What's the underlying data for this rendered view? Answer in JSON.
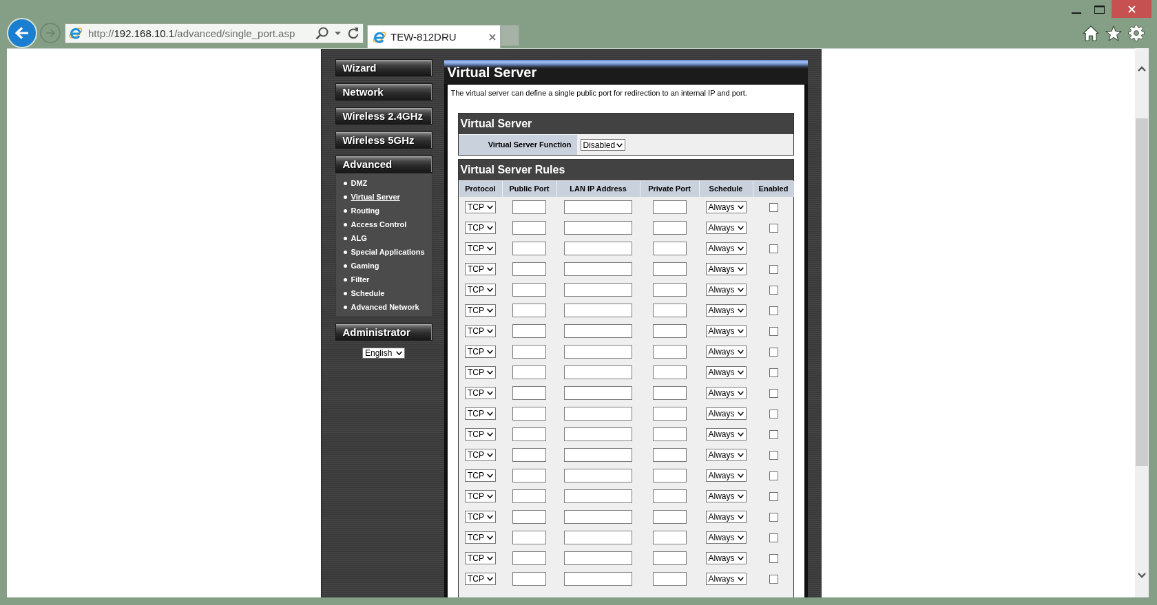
{
  "nav": {
    "back": {
      "disabled": false
    },
    "forward": {
      "disabled": true
    }
  },
  "address_bar": {
    "scheme": "http://",
    "host": "192.168.10.1",
    "path": "/advanced/single_port.asp"
  },
  "tabs": [
    {
      "title": "TEW-812DRU",
      "selected": true
    }
  ],
  "sidebar": {
    "sections": [
      {
        "label": "Wizard"
      },
      {
        "label": "Network"
      },
      {
        "label": "Wireless 2.4GHz"
      },
      {
        "label": "Wireless 5GHz"
      },
      {
        "label": "Advanced",
        "items": [
          {
            "label": "DMZ",
            "selected": false
          },
          {
            "label": "Virtual Server",
            "selected": true
          },
          {
            "label": "Routing",
            "selected": false
          },
          {
            "label": "Access Control",
            "selected": false
          },
          {
            "label": "ALG",
            "selected": false
          },
          {
            "label": "Special Applications",
            "selected": false
          },
          {
            "label": "Gaming",
            "selected": false
          },
          {
            "label": "Filter",
            "selected": false
          },
          {
            "label": "Schedule",
            "selected": false
          },
          {
            "label": "Advanced Network",
            "selected": false
          }
        ]
      },
      {
        "label": "Administrator"
      }
    ],
    "language": "English"
  },
  "main": {
    "title": "Virtual Server",
    "description": "The virtual server can define a single public port for redirection to an internal IP and port.",
    "function": {
      "title": "Virtual Server",
      "label": "Virtual Server Function",
      "value": "Disabled"
    },
    "rules": {
      "title": "Virtual Server Rules",
      "columns": [
        "Protocol",
        "Public Port",
        "LAN IP Address",
        "Private Port",
        "Schedule",
        "Enabled"
      ],
      "rows": [
        {
          "protocol": "TCP",
          "schedule": "Always",
          "enabled": false
        },
        {
          "protocol": "TCP",
          "schedule": "Always",
          "enabled": false
        },
        {
          "protocol": "TCP",
          "schedule": "Always",
          "enabled": false
        },
        {
          "protocol": "TCP",
          "schedule": "Always",
          "enabled": false
        },
        {
          "protocol": "TCP",
          "schedule": "Always",
          "enabled": false
        },
        {
          "protocol": "TCP",
          "schedule": "Always",
          "enabled": false
        },
        {
          "protocol": "TCP",
          "schedule": "Always",
          "enabled": false
        },
        {
          "protocol": "TCP",
          "schedule": "Always",
          "enabled": false
        },
        {
          "protocol": "TCP",
          "schedule": "Always",
          "enabled": false
        },
        {
          "protocol": "TCP",
          "schedule": "Always",
          "enabled": false
        },
        {
          "protocol": "TCP",
          "schedule": "Always",
          "enabled": false
        },
        {
          "protocol": "TCP",
          "schedule": "Always",
          "enabled": false
        },
        {
          "protocol": "TCP",
          "schedule": "Always",
          "enabled": false
        },
        {
          "protocol": "TCP",
          "schedule": "Always",
          "enabled": false
        },
        {
          "protocol": "TCP",
          "schedule": "Always",
          "enabled": false
        },
        {
          "protocol": "TCP",
          "schedule": "Always",
          "enabled": false
        },
        {
          "protocol": "TCP",
          "schedule": "Always",
          "enabled": false
        },
        {
          "protocol": "TCP",
          "schedule": "Always",
          "enabled": false
        },
        {
          "protocol": "TCP",
          "schedule": "Always",
          "enabled": false
        }
      ]
    }
  }
}
